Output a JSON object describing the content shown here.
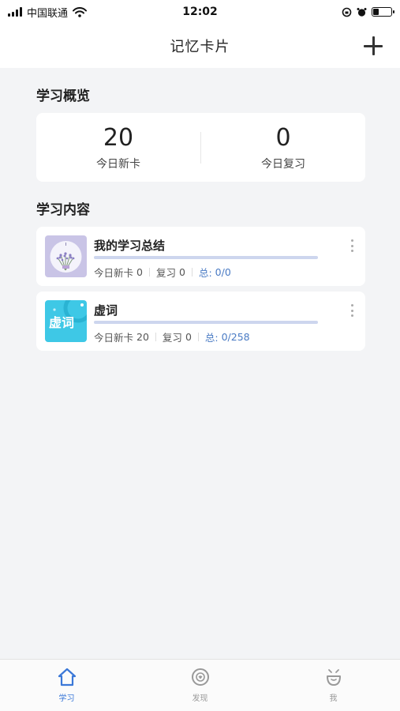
{
  "status_bar": {
    "carrier": "中国联通",
    "time": "12:02",
    "battery_level": 0.3
  },
  "nav": {
    "title": "记忆卡片",
    "add_icon": "plus-icon"
  },
  "overview": {
    "section_title": "学习概览",
    "new_cards_value": "20",
    "new_cards_label": "今日新卡",
    "review_value": "0",
    "review_label": "今日复习"
  },
  "content": {
    "section_title": "学习内容",
    "decks": [
      {
        "name": "我的学习总结",
        "thumb_icon": "lavender-thumbnail",
        "progress": 0,
        "new_label": "今日新卡",
        "new_value": "0",
        "review_label": "复习",
        "review_value": "0",
        "total_label": "总:",
        "total_value": "0/0"
      },
      {
        "name": "虚词",
        "thumb_icon": "xuci-thumbnail",
        "thumb_text": "虚词",
        "progress": 0,
        "new_label": "今日新卡",
        "new_value": "20",
        "review_label": "复习",
        "review_value": "0",
        "total_label": "总:",
        "total_value": "0/258"
      }
    ]
  },
  "tabs": [
    {
      "label": "学习",
      "icon": "home-icon",
      "active": true
    },
    {
      "label": "发现",
      "icon": "discover-icon",
      "active": false
    },
    {
      "label": "我",
      "icon": "profile-icon",
      "active": false
    }
  ],
  "colors": {
    "accent": "#3b78d8",
    "background": "#f3f4f6",
    "progress_track": "#cdd6ee",
    "total_text": "#4a7bc4"
  }
}
